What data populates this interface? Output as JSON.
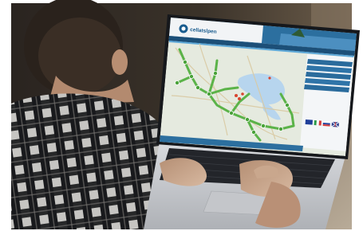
{
  "scene": {
    "description_colors": {
      "background_wall": "#2b2520",
      "shirt_dark": "#1e1f22",
      "shirt_light": "#e7e6e3",
      "skin": "#c7a88e",
      "laptop_silver": "#c9cbcf",
      "screen_bezel": "#1a1c20",
      "header_blue": "#1f5f8e",
      "map_land": "#e6ebe1",
      "lake_blue": "#b9d6ef",
      "route_green": "#58b247"
    }
  },
  "app": {
    "logo_name": "cellatslpen",
    "icons": {
      "logo": "logo-mark-icon",
      "flags": [
        "flag-eu-icon",
        "flag-it-icon",
        "flag-si-icon",
        "flag-uk-icon"
      ]
    }
  }
}
